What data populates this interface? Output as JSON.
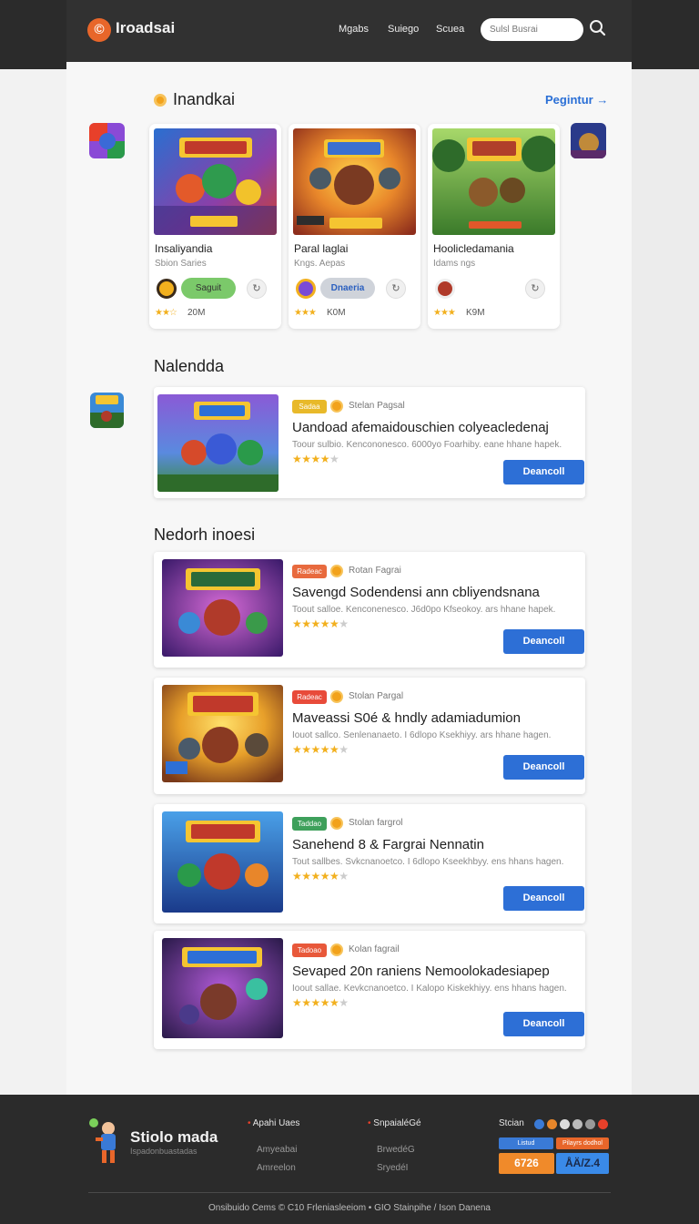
{
  "header": {
    "logo_glyph": "©",
    "brand": "Iroadsai",
    "nav": [
      "Mgabs",
      "Suiego",
      "Scuea"
    ],
    "search_placeholder": "Sulsl Busrai"
  },
  "featured": {
    "title": "Inandkai",
    "register_label": "Pegintur →",
    "cards": [
      {
        "name": "Insaliyandia",
        "sub": "Sbion Saries",
        "pill": "Saguit",
        "pill_color": "#7bc96a",
        "stars": "★★☆",
        "count": "20M"
      },
      {
        "name": "Paral laglai",
        "sub": "Kngs. Aepas",
        "pill": "Dnaeria",
        "pill_color": "#cfd3da",
        "stars": "★★★",
        "count": "K0M"
      },
      {
        "name": "Hoolicledamania",
        "sub": "Idams ngs",
        "pill": "",
        "pill_color": "",
        "stars": "★★★",
        "count": "K9M"
      }
    ]
  },
  "newest": {
    "title": "Nalendda",
    "card": {
      "tag": "Sadaa",
      "tag_color": "#e8b92a",
      "meta": "Stelan Pagsal",
      "title": "Uandoad afemaidouschien colyeacledenaj",
      "desc": "Toour sulbio. Kencononesco. 6000yo Foarhiby. eane hhane hapek.",
      "stars_on": "★★★★",
      "stars_off": "★",
      "download": "Deancoll"
    }
  },
  "popular": {
    "title": "Nedorh inoesi",
    "cards": [
      {
        "tag": "Radeac",
        "tag_color": "#e86a3e",
        "meta": "Rotan Fagrai",
        "title": "Savengd Sodendensi ann cbliyendsnana",
        "desc": "Toout salloe. Kenconenesco. J6d0po Kfseokoy. ars hhane hapek.",
        "download": "Deancoll"
      },
      {
        "tag": "Radeac",
        "tag_color": "#e84b3a",
        "meta": "Stolan Pargal",
        "title": "Maveassi S0é & hndly adamiadumion",
        "desc": "Iouot sallco. Senlenanaeto. I 6dlopo Ksekhiyy. ars hhane hagen.",
        "download": "Deancoll"
      },
      {
        "tag": "Taddao",
        "tag_color": "#3ea05b",
        "meta": "Stolan fargrol",
        "title": "Sanehend 8 & Fargrai Nennatin",
        "desc": "Tout sallbes. Svkcnanoetco. I 6dlopo Kseekhbyy. ens hhans hagen.",
        "download": "Deancoll"
      },
      {
        "tag": "Tadoao",
        "tag_color": "#e8583a",
        "meta": "Kolan fagrail",
        "title": "Sevaped 20n raniens Nemoolokadesiapep",
        "desc": "Ioout sallae. Kevkcnanoetco. I Kalopo Kiskekhiyy. ens hhans hagen.",
        "download": "Deancoll"
      }
    ]
  },
  "footer": {
    "brand": "Stiolo mada",
    "tagline": "Ispadonbuastadas",
    "col1": {
      "heading": "Apahi Uaes",
      "links": [
        "Amyeabai",
        "Amreelon"
      ]
    },
    "col2": {
      "heading": "SnpaialéGé",
      "links": [
        "BrwedéG",
        "SryedéI"
      ]
    },
    "social_heading": "Stcian",
    "badge1": "Listud",
    "badge2": "Pilayrs dodhol",
    "stat1": "6726",
    "stat2": "ÅÄ/Z.4",
    "copyright": "Onsibuido Cems © C10 Frleniasleeiom • GIO Stainpihe / Ison Danena"
  }
}
